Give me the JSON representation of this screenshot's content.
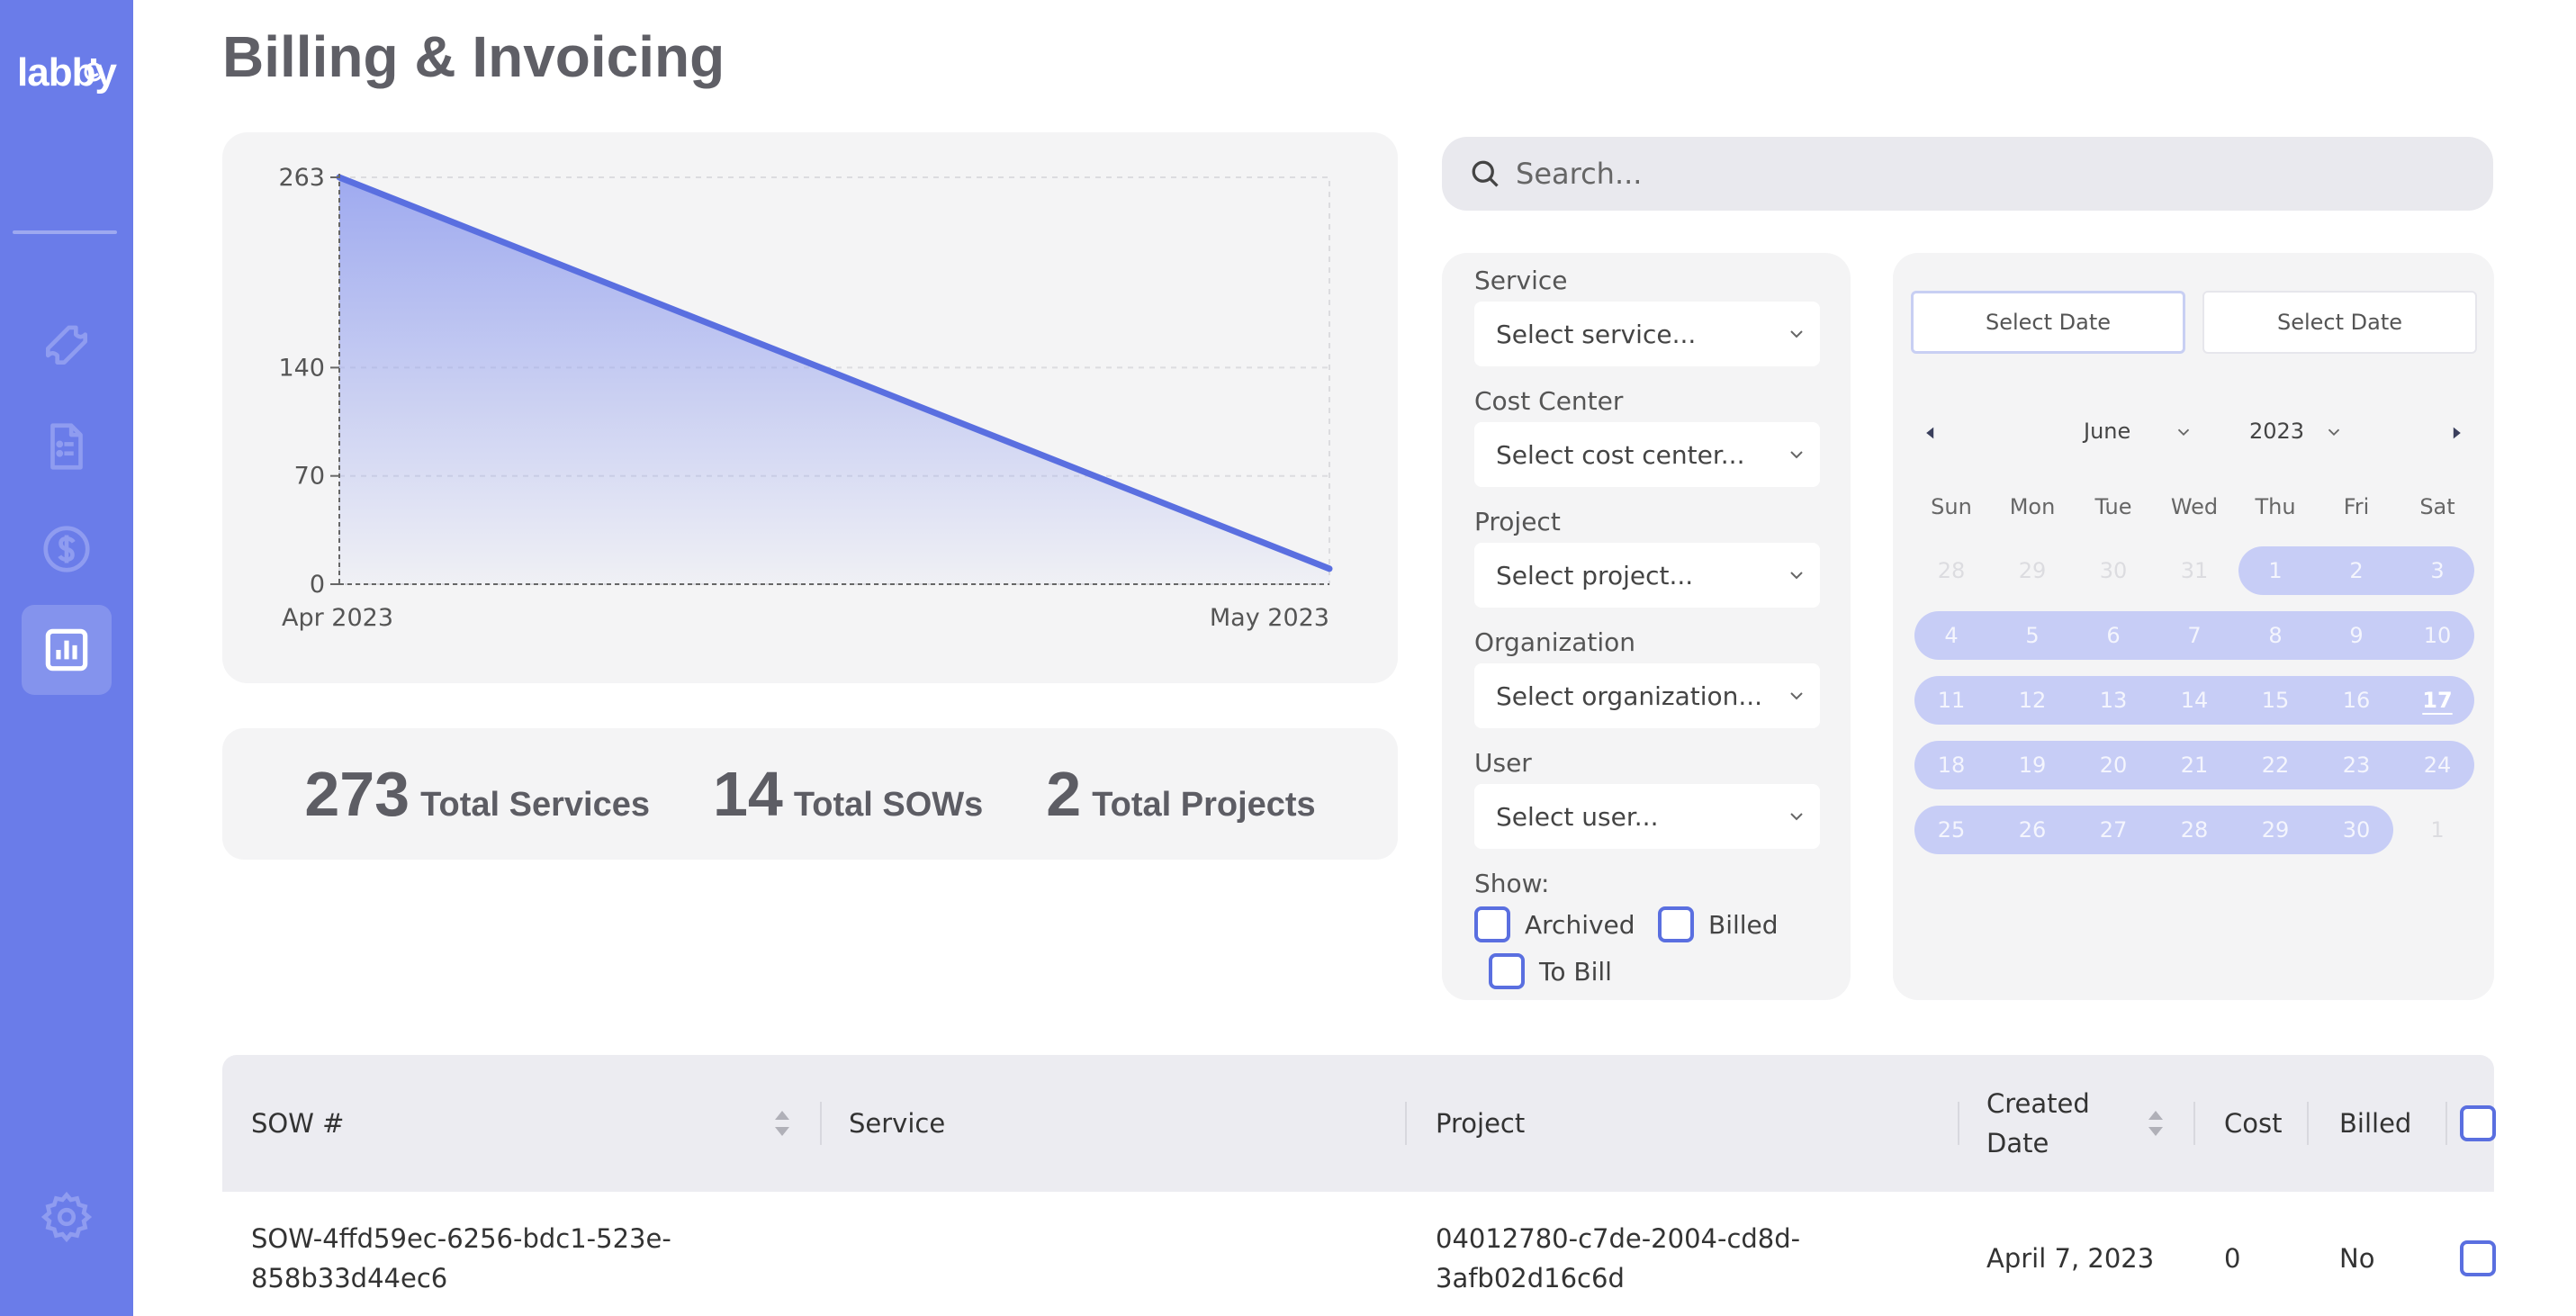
{
  "app": {
    "logo": "labby",
    "title": "Billing & Invoicing"
  },
  "sidebar": {
    "items": [
      {
        "icon": "ticket-icon"
      },
      {
        "icon": "document-list-icon"
      },
      {
        "icon": "dollar-circle-icon"
      },
      {
        "icon": "bar-chart-icon",
        "active": true
      }
    ],
    "footer_icon": "gear-icon"
  },
  "chart_data": {
    "type": "area",
    "x": [
      "Apr 2023",
      "May 2023"
    ],
    "values": [
      263,
      10
    ],
    "yticks": [
      0,
      70,
      140,
      263
    ],
    "ylim": [
      0,
      263
    ],
    "grid": true,
    "line_color": "#5a6fe0",
    "fill_color": "#9aa6ef"
  },
  "stats": [
    {
      "value": "273",
      "label": "Total Services"
    },
    {
      "value": "14",
      "label": "Total SOWs"
    },
    {
      "value": "2",
      "label": "Total Projects"
    }
  ],
  "search": {
    "placeholder": "Search..."
  },
  "filters": {
    "service": {
      "label": "Service",
      "placeholder": "Select service..."
    },
    "cost_center": {
      "label": "Cost Center",
      "placeholder": "Select cost center..."
    },
    "project": {
      "label": "Project",
      "placeholder": "Select project..."
    },
    "organization": {
      "label": "Organization",
      "placeholder": "Select organization..."
    },
    "user": {
      "label": "User",
      "placeholder": "Select user..."
    },
    "show_label": "Show:",
    "show": {
      "archived": "Archived",
      "billed": "Billed",
      "to_bill": "To Bill"
    }
  },
  "calendar": {
    "start_button": "Select Date",
    "end_button": "Select Date",
    "month": "June",
    "year": "2023",
    "weekdays": [
      "Sun",
      "Mon",
      "Tue",
      "Wed",
      "Thu",
      "Fri",
      "Sat"
    ],
    "weeks": [
      [
        "28",
        "29",
        "30",
        "31",
        "1",
        "2",
        "3"
      ],
      [
        "4",
        "5",
        "6",
        "7",
        "8",
        "9",
        "10"
      ],
      [
        "11",
        "12",
        "13",
        "14",
        "15",
        "16",
        "17"
      ],
      [
        "18",
        "19",
        "20",
        "21",
        "22",
        "23",
        "24"
      ],
      [
        "25",
        "26",
        "27",
        "28",
        "29",
        "30",
        "1"
      ]
    ],
    "today": "17",
    "accent": "#c7cdf6"
  },
  "table": {
    "headers": {
      "sow": "SOW #",
      "service": "Service",
      "project": "Project",
      "created_line1": "Created",
      "created_line2": "Date",
      "cost": "Cost",
      "billed": "Billed"
    },
    "rows": [
      {
        "sow_line1": "SOW-4ffd59ec-6256-bdc1-523e-",
        "sow_line2": "858b33d44ec6",
        "service": "",
        "project_line1": "04012780-c7de-2004-cd8d-",
        "project_line2": "3afb02d16c6d",
        "created": "April 7, 2023",
        "cost": "0",
        "billed": "No"
      }
    ]
  },
  "colors": {
    "sidebar": "#6a7ce9",
    "accent": "#5a6fe0",
    "card": "#f4f4f5"
  }
}
